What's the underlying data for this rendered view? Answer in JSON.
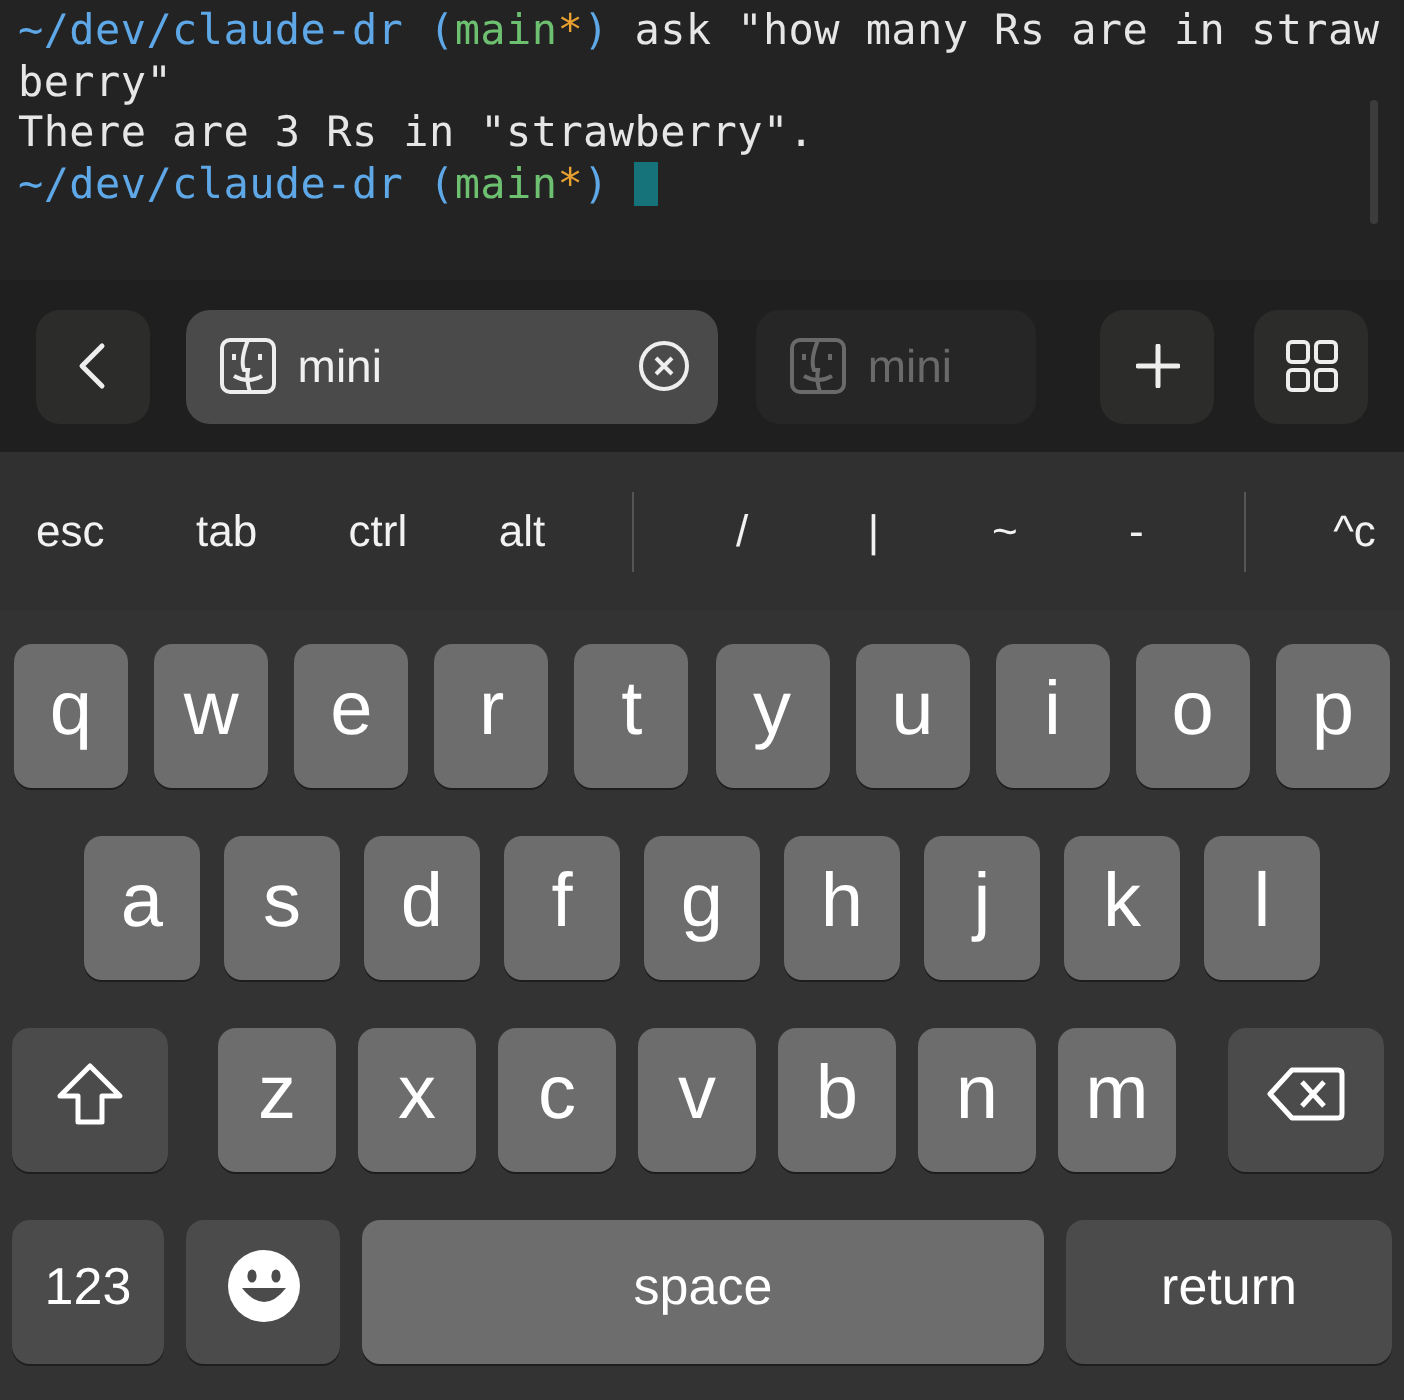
{
  "terminal": {
    "lines": [
      [
        {
          "kind": "path",
          "text": "~/dev/claude-dr ("
        },
        {
          "kind": "branch",
          "text": "main"
        },
        {
          "kind": "dirty",
          "text": "*"
        },
        {
          "kind": "path",
          "text": ")"
        },
        {
          "kind": "plain",
          "text": " ask \"how many Rs are in straw"
        }
      ],
      [
        {
          "kind": "plain",
          "text": "berry\""
        }
      ],
      [
        {
          "kind": "plain",
          "text": "There are 3 Rs in \"strawberry\"."
        }
      ],
      [
        {
          "kind": "path",
          "text": "~/dev/claude-dr ("
        },
        {
          "kind": "branch",
          "text": "main"
        },
        {
          "kind": "dirty",
          "text": "*"
        },
        {
          "kind": "path",
          "text": ")"
        },
        {
          "kind": "cursor"
        }
      ]
    ]
  },
  "tab_bar": {
    "tabs": [
      {
        "label": "mini",
        "selected": true
      },
      {
        "label": "mini",
        "selected": false
      }
    ]
  },
  "accessory_keys": [
    {
      "kind": "key",
      "label": "esc"
    },
    {
      "kind": "key",
      "label": "tab"
    },
    {
      "kind": "key",
      "label": "ctrl"
    },
    {
      "kind": "key",
      "label": "alt"
    },
    {
      "kind": "separator"
    },
    {
      "kind": "key",
      "label": "/"
    },
    {
      "kind": "key",
      "label": "|"
    },
    {
      "kind": "key",
      "label": "~"
    },
    {
      "kind": "key",
      "label": "-"
    },
    {
      "kind": "separator"
    },
    {
      "kind": "key",
      "label": "^c"
    }
  ],
  "keyboard": {
    "rows": [
      {
        "keys": [
          {
            "kind": "letter",
            "label": "q"
          },
          {
            "kind": "letter",
            "label": "w"
          },
          {
            "kind": "letter",
            "label": "e"
          },
          {
            "kind": "letter",
            "label": "r"
          },
          {
            "kind": "letter",
            "label": "t"
          },
          {
            "kind": "letter",
            "label": "y"
          },
          {
            "kind": "letter",
            "label": "u"
          },
          {
            "kind": "letter",
            "label": "i"
          },
          {
            "kind": "letter",
            "label": "o"
          },
          {
            "kind": "letter",
            "label": "p"
          }
        ]
      },
      {
        "keys": [
          {
            "kind": "letter",
            "label": "a"
          },
          {
            "kind": "letter",
            "label": "s"
          },
          {
            "kind": "letter",
            "label": "d"
          },
          {
            "kind": "letter",
            "label": "f"
          },
          {
            "kind": "letter",
            "label": "g"
          },
          {
            "kind": "letter",
            "label": "h"
          },
          {
            "kind": "letter",
            "label": "j"
          },
          {
            "kind": "letter",
            "label": "k"
          },
          {
            "kind": "letter",
            "label": "l"
          }
        ]
      },
      {
        "keys": [
          {
            "kind": "shift"
          },
          {
            "kind": "letter",
            "label": "z"
          },
          {
            "kind": "letter",
            "label": "x"
          },
          {
            "kind": "letter",
            "label": "c"
          },
          {
            "kind": "letter",
            "label": "v"
          },
          {
            "kind": "letter",
            "label": "b"
          },
          {
            "kind": "letter",
            "label": "n"
          },
          {
            "kind": "letter",
            "label": "m"
          },
          {
            "kind": "delete"
          }
        ]
      },
      {
        "keys": [
          {
            "kind": "numbers",
            "label": "123"
          },
          {
            "kind": "emoji"
          },
          {
            "kind": "space",
            "label": "space"
          },
          {
            "kind": "return",
            "label": "return"
          }
        ]
      }
    ]
  }
}
